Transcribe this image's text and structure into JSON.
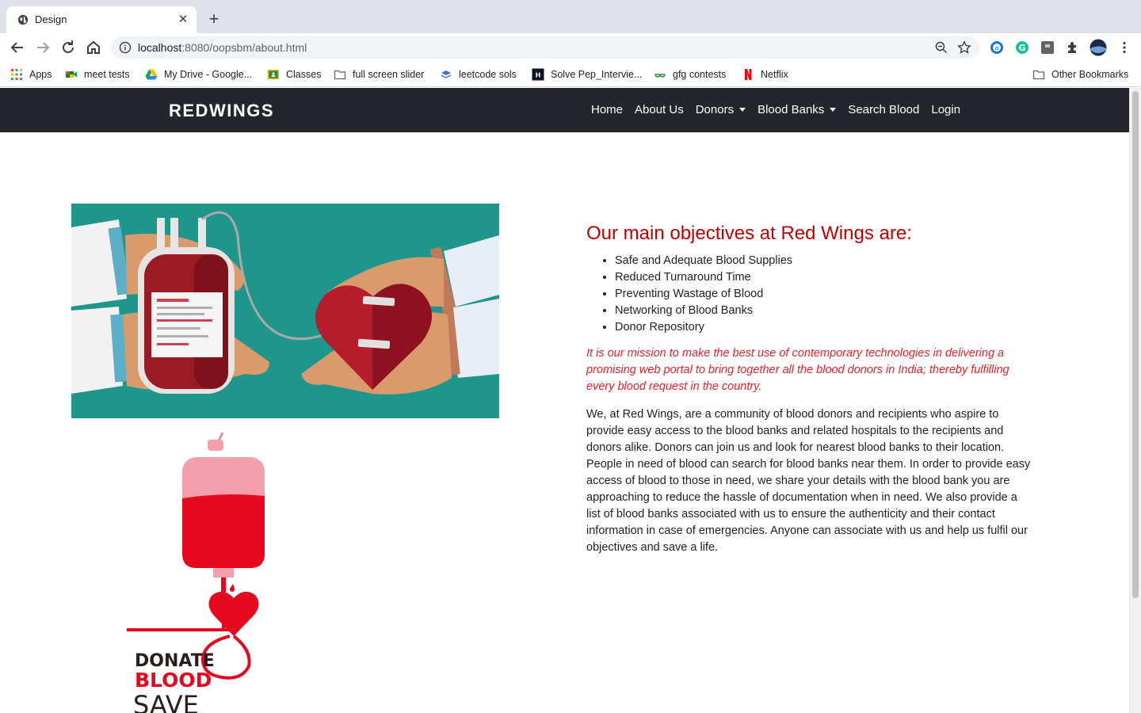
{
  "browser": {
    "tab_title": "Design",
    "url_host": "localhost",
    "url_path": ":8080/oopsbm/about.html",
    "bookmarks": [
      {
        "label": "Apps",
        "icon": "apps-grid-icon"
      },
      {
        "label": "meet tests",
        "icon": "google-meet-icon"
      },
      {
        "label": "My Drive - Google...",
        "icon": "google-drive-icon"
      },
      {
        "label": "Classes",
        "icon": "google-classroom-icon"
      },
      {
        "label": "full screen slider",
        "icon": "folder-icon"
      },
      {
        "label": "leetcode sols",
        "icon": "layers-icon"
      },
      {
        "label": "Solve Pep_Intervie...",
        "icon": "hackerrank-icon"
      },
      {
        "label": "gfg contests",
        "icon": "gfg-icon"
      },
      {
        "label": "Netflix",
        "icon": "netflix-icon"
      }
    ],
    "other_bookmarks": "Other Bookmarks"
  },
  "site": {
    "brand": "REDWINGS",
    "nav": {
      "home": "Home",
      "about": "About Us",
      "donors": "Donors",
      "blood_banks": "Blood Banks",
      "search": "Search Blood",
      "login": "Login"
    },
    "objectives_title": "Our main objectives at Red Wings are:",
    "objectives": [
      "Safe and Adequate Blood Supplies",
      "Reduced Turnaround Time",
      "Preventing Wastage of Blood",
      "Networking of Blood Banks",
      "Donor Repository"
    ],
    "mission": "It is our mission to make the best use of contemporary technologies in delivering a promising web portal to bring together all the blood donors in India; thereby fulfilling every blood request in the country.",
    "about": "We, at Red Wings, are a community of blood donors and recipients who aspire to provide easy access to the blood banks and related hospitals to the recipients and donors alike. Donors can join us and look for nearest blood banks to their location. People in need of blood can search for blood banks near them. In order to provide easy access of blood to those in need, we share your details with the blood bank you are approaching to reduce the hassle of documentation when in need. We also provide a list of blood banks associated with us to ensure the authenticity and their contact information in case of emergencies. Anyone can associate with us and help us fulfil our objectives and save a life.",
    "logo_text": {
      "line1": "DONATE",
      "line2": "BLOOD",
      "line3": "SAVE"
    }
  },
  "colors": {
    "navbar_bg": "#23272b",
    "heading_red": "#c00000",
    "mission_red": "#e3242b",
    "teal": "#1f968b"
  }
}
